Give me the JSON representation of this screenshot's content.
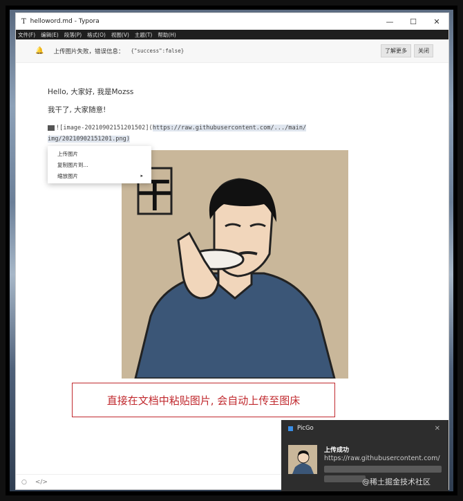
{
  "titlebar": {
    "app_icon": "T",
    "title": "helloword.md - Typora",
    "controls": {
      "minimize": "—",
      "maximize": "☐",
      "close": "✕"
    }
  },
  "menubar": [
    "文件(F)",
    "编辑(E)",
    "段落(P)",
    "格式(O)",
    "视图(V)",
    "主题(T)",
    "帮助(H)"
  ],
  "notice": {
    "bell_icon": "🔔",
    "message": "上传图片失败，错误信息：",
    "code": "{\"success\":false}",
    "learn_more": "了解更多",
    "close": "关闭"
  },
  "doc": {
    "line1": "Hello, 大家好, 我是Mozss",
    "line2": "我干了, 大家随意!",
    "md_prefix": "![image-20210902151201502](",
    "md_url": "https://raw.githubusercontent.com/.../main/",
    "md_line2": "img/20210902151201.png)",
    "image_glyph": "干"
  },
  "context_menu": {
    "items": [
      "上传图片",
      "复制图片到...",
      "缩放图片"
    ],
    "submenu_arrow": "▸"
  },
  "caption": "直接在文档中粘贴图片, 会自动上传至图床",
  "statusbar": {
    "left_icon": "○",
    "source_icon": "</>"
  },
  "toast": {
    "app": "PicGo",
    "close": "✕",
    "title": "上传成功",
    "url": "https://raw.githubusercontent.com/"
  },
  "watermark": "@稀土掘金技术社区",
  "colors": {
    "accent_red": "#c0282d",
    "menubar": "#1f1f1f",
    "toast_bg": "#2d2d2d",
    "shirt": "#3b5677"
  }
}
